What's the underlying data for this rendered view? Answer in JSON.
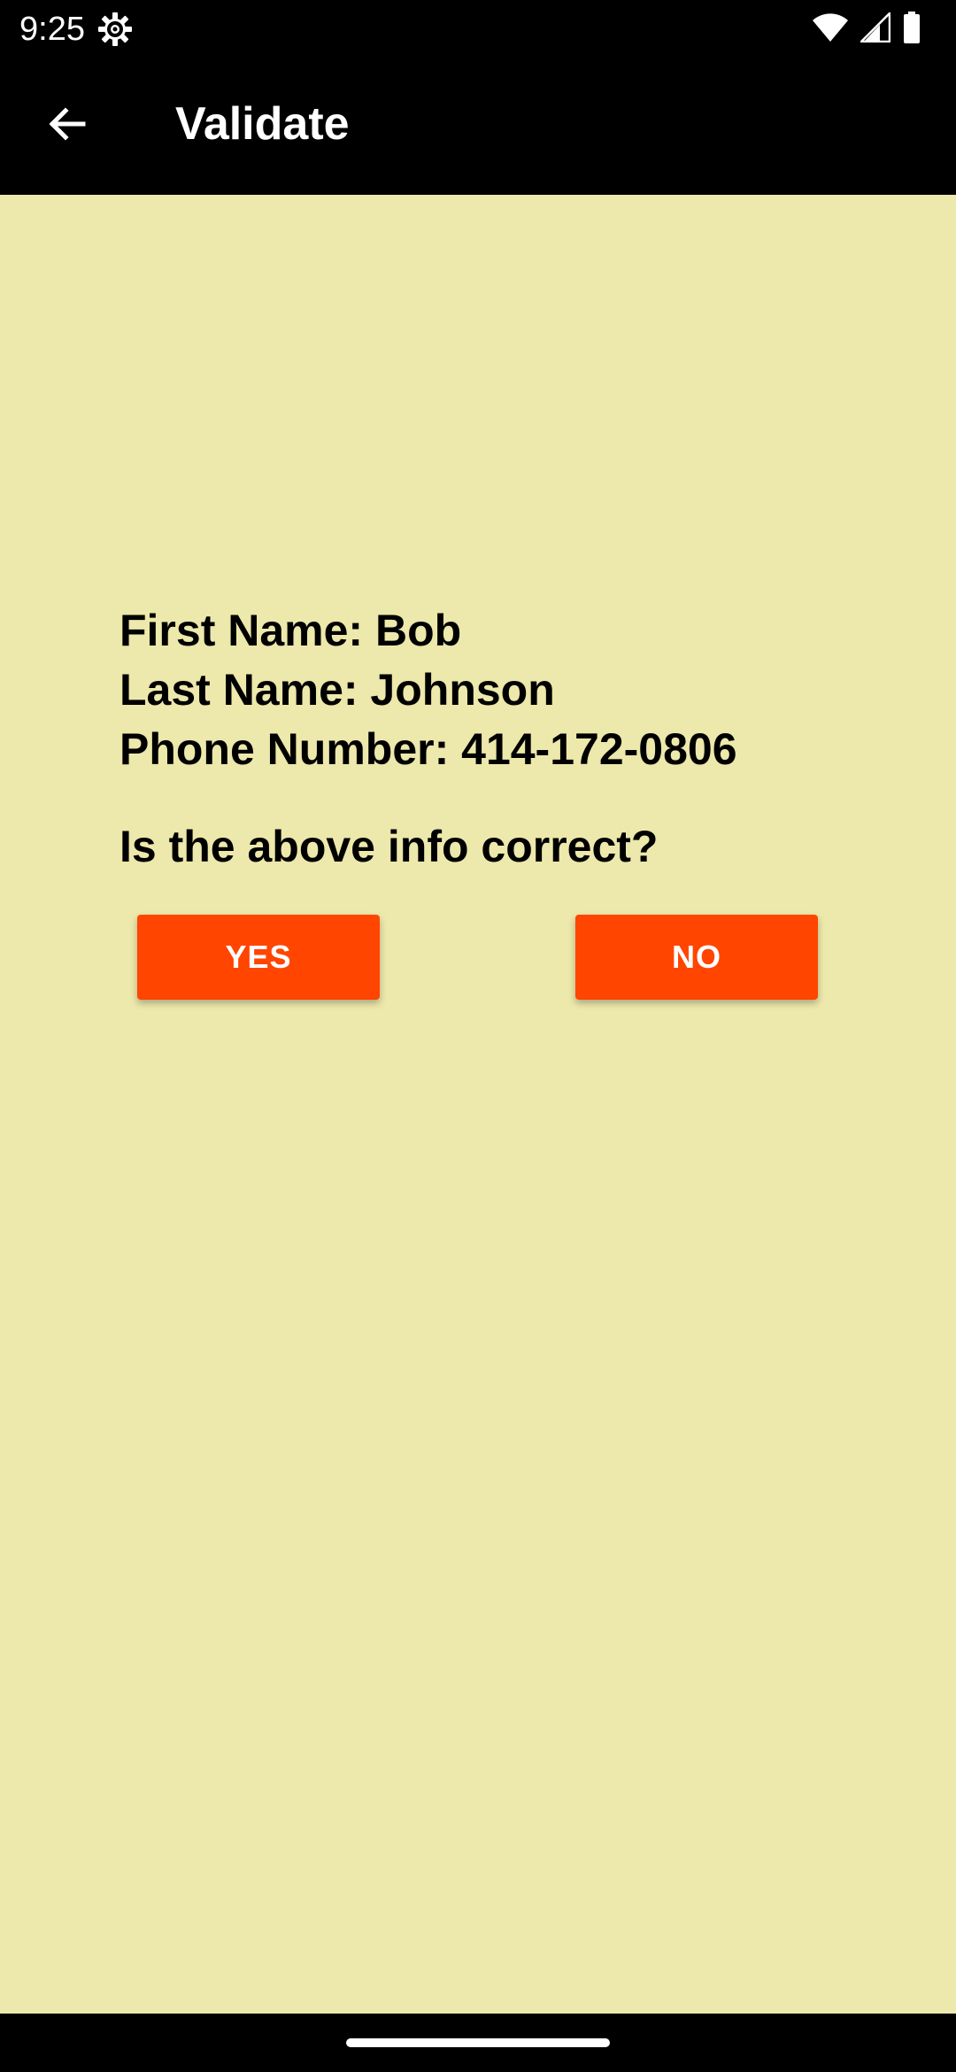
{
  "status_bar": {
    "time": "9:25",
    "icons": [
      "settings-gear-icon",
      "wifi-icon",
      "cellular-signal-icon",
      "battery-icon"
    ]
  },
  "app_bar": {
    "title": "Validate",
    "back_icon": "arrow-back-icon"
  },
  "info": {
    "first_name": "First Name: Bob",
    "last_name": "Last Name: Johnson",
    "phone": "Phone Number: 414-172-0806"
  },
  "question": "Is the above info correct?",
  "buttons": {
    "yes_label": "YES",
    "no_label": "NO"
  },
  "colors": {
    "background": "#ede8ab",
    "bar": "#000000",
    "button": "#ff4500",
    "button_text": "#ffffff"
  }
}
